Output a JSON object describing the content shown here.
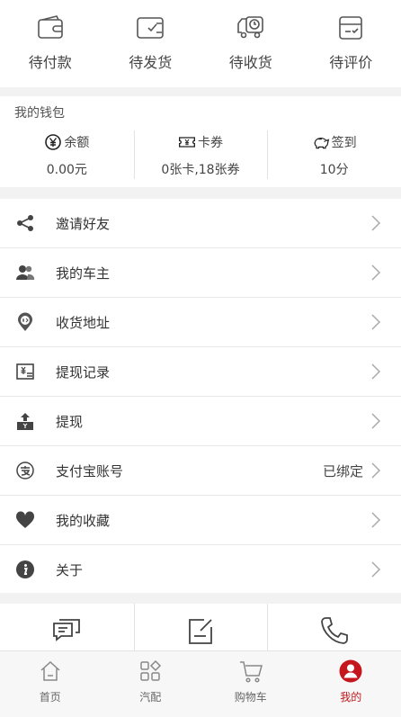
{
  "orders": [
    {
      "label": "待付款",
      "icon": "wallet-icon"
    },
    {
      "label": "待发货",
      "icon": "shipment-icon"
    },
    {
      "label": "待收货",
      "icon": "delivery-truck-icon"
    },
    {
      "label": "待评价",
      "icon": "review-box-icon"
    }
  ],
  "wallet": {
    "title": "我的钱包",
    "balance": {
      "label": "余额",
      "value": "0.00元",
      "icon": "yen-coin-icon"
    },
    "cards": {
      "label": "卡券",
      "value": "0张卡,18张券",
      "icon": "ticket-icon"
    },
    "checkin": {
      "label": "签到",
      "value": "10分",
      "icon": "piggy-bank-icon"
    }
  },
  "menu": [
    {
      "label": "邀请好友",
      "icon": "share-icon"
    },
    {
      "label": "我的车主",
      "icon": "users-icon"
    },
    {
      "label": "收货地址",
      "icon": "location-pin-icon"
    },
    {
      "label": "提现记录",
      "icon": "withdraw-record-icon"
    },
    {
      "label": "提现",
      "icon": "withdraw-icon"
    },
    {
      "label": "支付宝账号",
      "icon": "alipay-icon",
      "value": "已绑定"
    },
    {
      "label": "我的收藏",
      "icon": "heart-icon"
    },
    {
      "label": "关于",
      "icon": "info-icon"
    }
  ],
  "quick_actions": [
    {
      "icon": "message-icon"
    },
    {
      "icon": "edit-note-icon"
    },
    {
      "icon": "phone-icon"
    }
  ],
  "tabs": [
    {
      "label": "首页",
      "icon": "home-icon",
      "active": false
    },
    {
      "label": "汽配",
      "icon": "categories-icon",
      "active": false
    },
    {
      "label": "购物车",
      "icon": "cart-icon",
      "active": false
    },
    {
      "label": "我的",
      "icon": "profile-icon",
      "active": true
    }
  ],
  "colors": {
    "accent": "#c4161c",
    "icon_gray": "#555555",
    "background": "#f2f2f2"
  }
}
